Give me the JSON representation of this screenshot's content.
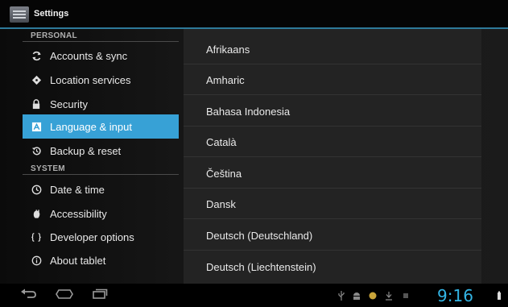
{
  "app": {
    "title": "Settings"
  },
  "sidebar": {
    "personal_header": "PERSONAL",
    "system_header": "SYSTEM",
    "personal_items": [
      {
        "label": "Accounts & sync",
        "icon": "sync-icon"
      },
      {
        "label": "Location services",
        "icon": "location-icon"
      },
      {
        "label": "Security",
        "icon": "lock-icon"
      },
      {
        "label": "Language & input",
        "icon": "language-icon",
        "selected": true
      },
      {
        "label": "Backup & reset",
        "icon": "backup-icon"
      }
    ],
    "system_items": [
      {
        "label": "Date & time",
        "icon": "clock-icon"
      },
      {
        "label": "Accessibility",
        "icon": "accessibility-icon"
      },
      {
        "label": "Developer options",
        "icon": "braces-icon"
      },
      {
        "label": "About tablet",
        "icon": "info-icon"
      }
    ]
  },
  "languages": [
    "Afrikaans",
    "Amharic",
    "Bahasa Indonesia",
    "Català",
    "Čeština",
    "Dansk",
    "Deutsch (Deutschland)",
    "Deutsch (Liechtenstein)"
  ],
  "statusbar": {
    "time": "9:16"
  },
  "colors": {
    "accent": "#33b5e5",
    "selection": "#37a1d6"
  }
}
